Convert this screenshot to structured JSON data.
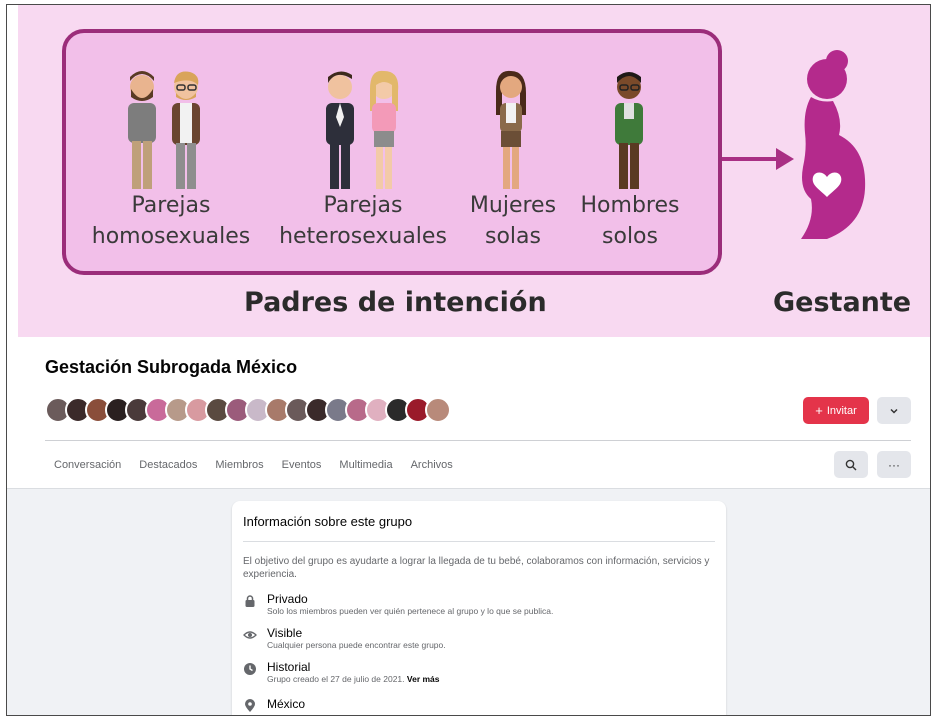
{
  "banner": {
    "parents": [
      {
        "line1": "Parejas",
        "line2": "homosexuales"
      },
      {
        "line1": "Parejas",
        "line2": "heterosexuales"
      },
      {
        "line1": "Mujeres",
        "line2": "solas"
      },
      {
        "line1": "Hombres",
        "line2": "solos"
      }
    ],
    "caption_parents": "Padres de intención",
    "caption_surrogate": "Gestante",
    "colors": {
      "background": "#f8d9f1",
      "box_fill": "#f2bfe9",
      "box_border": "#9b2d7a",
      "accent": "#a92f84",
      "silhouette": "#b42a8c"
    }
  },
  "group": {
    "title": "Gestación Subrogada México",
    "invite_label": "Invitar",
    "tabs": [
      "Conversación",
      "Destacados",
      "Miembros",
      "Eventos",
      "Multimedia",
      "Archivos"
    ],
    "icons": {
      "invite": "plus-icon",
      "expand": "chevron-down-icon",
      "search": "search-icon",
      "more": "more-icon"
    }
  },
  "about": {
    "title": "Información sobre este grupo",
    "description": "El objetivo del grupo es ayudarte a lograr la llegada de tu bebé, colaboramos con información, servicios y experiencia.",
    "items": [
      {
        "icon": "lock-icon",
        "title": "Privado",
        "subtitle": "Solo los miembros pueden ver quién pertenece al grupo y lo que se publica."
      },
      {
        "icon": "eye-icon",
        "title": "Visible",
        "subtitle": "Cualquier persona puede encontrar este grupo."
      },
      {
        "icon": "clock-icon",
        "title": "Historial",
        "subtitle": "Grupo creado el 27 de julio de 2021.",
        "link": "Ver más"
      },
      {
        "icon": "location-pin-icon",
        "title": "México"
      }
    ]
  }
}
